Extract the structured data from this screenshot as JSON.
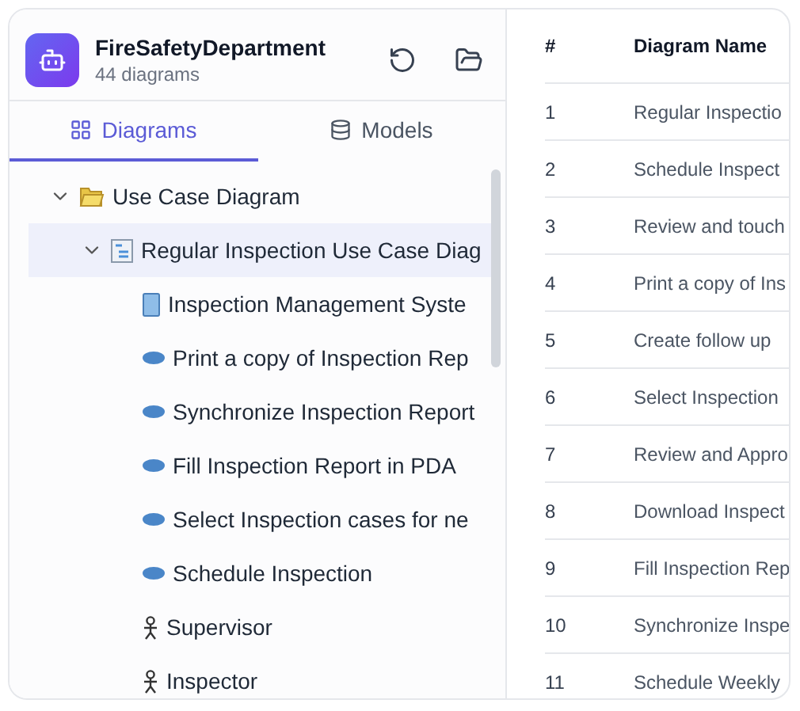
{
  "project": {
    "name": "FireSafetyDepartment",
    "subtitle": "44 diagrams"
  },
  "tabs": [
    {
      "label": "Diagrams",
      "kind": "grid",
      "selected": true
    },
    {
      "label": "Models",
      "kind": "database",
      "selected": false
    }
  ],
  "tree": [
    {
      "label": "Use Case Diagram",
      "kind": "folder",
      "expanded": true,
      "selected": false,
      "children": [
        {
          "label": "Regular Inspection Use Case Diag",
          "kind": "diagram",
          "expanded": true,
          "selected": true,
          "children": [
            {
              "label": "Inspection Management Syste",
              "kind": "system",
              "selected": false
            },
            {
              "label": "Print a copy of Inspection Rep",
              "kind": "usecase",
              "selected": false
            },
            {
              "label": "Synchronize Inspection Report",
              "kind": "usecase",
              "selected": false
            },
            {
              "label": "Fill Inspection Report in PDA",
              "kind": "usecase",
              "selected": false
            },
            {
              "label": "Select Inspection cases for ne",
              "kind": "usecase",
              "selected": false
            },
            {
              "label": "Schedule Inspection",
              "kind": "usecase",
              "selected": false
            },
            {
              "label": "Supervisor",
              "kind": "actor",
              "selected": false
            },
            {
              "label": "Inspector",
              "kind": "actor",
              "selected": false
            }
          ]
        }
      ]
    }
  ],
  "table": {
    "columns": [
      "#",
      "Diagram Name"
    ],
    "rows": [
      [
        "1",
        "Regular Inspectio"
      ],
      [
        "2",
        "Schedule Inspect"
      ],
      [
        "3",
        "Review and touch"
      ],
      [
        "4",
        "Print a copy of Ins"
      ],
      [
        "5",
        "Create follow up"
      ],
      [
        "6",
        "Select Inspection"
      ],
      [
        "7",
        "Review and Appro"
      ],
      [
        "8",
        "Download Inspect"
      ],
      [
        "9",
        "Fill Inspection Rep"
      ],
      [
        "10",
        "Synchronize Inspe"
      ],
      [
        "11",
        "Schedule Weekly"
      ]
    ]
  }
}
